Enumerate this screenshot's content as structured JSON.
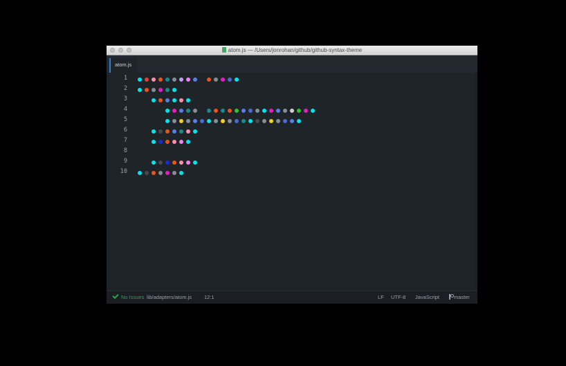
{
  "window": {
    "title": "atom.js — /Users/jonrohan/github/github-syntax-theme",
    "file_icon": "file-icon",
    "traffic_lights": [
      "close-button",
      "minimize-button",
      "zoom-button"
    ]
  },
  "tabs": [
    {
      "label": "atom.js",
      "active": true
    }
  ],
  "editor": {
    "line_numbers": [
      "1",
      "2",
      "3",
      "4",
      "5",
      "6",
      "7",
      "8",
      "9",
      "10"
    ],
    "colors": {
      "c": "#00e5ee",
      "r": "#e04040",
      "o": "#e8541e",
      "b": "#5a7ee8",
      "t": "#1a8a8a",
      "p": "#ee82ee",
      "g": "#888e96",
      "k": "#ff8fb0",
      "m": "#e020c0",
      "d": "#4a4a4a",
      "n": "#1a2ad8",
      "y": "#f0d020",
      "w": "#d0d0d0",
      "G": "#30c030",
      "l": "#c0a0f0",
      "B": "#4a6ad0"
    },
    "lines": [
      [
        "c",
        "r",
        "k",
        "o",
        "t",
        "g",
        "l",
        "p",
        "b",
        "_",
        "o",
        "g",
        "m",
        "B",
        "c"
      ],
      [
        "c",
        "o",
        "g",
        "m",
        "t",
        "c"
      ],
      [
        "_",
        "_",
        "c",
        "o",
        "b",
        "c",
        "k",
        "c"
      ],
      [
        "_",
        "_",
        "_",
        "_",
        "c",
        "m",
        "b",
        "t",
        "g",
        "_",
        "t",
        "o",
        "t",
        "o",
        "G",
        "b",
        "B",
        "g",
        "c",
        "m",
        "b",
        "g",
        "w",
        "G",
        "m",
        "c"
      ],
      [
        "_",
        "_",
        "_",
        "_",
        "c",
        "g",
        "y",
        "g",
        "b",
        "B",
        "c",
        "g",
        "y",
        "g",
        "B",
        "t",
        "c",
        "d",
        "g",
        "y",
        "g",
        "B",
        "b",
        "c"
      ],
      [
        "_",
        "_",
        "c",
        "d",
        "o",
        "b",
        "t",
        "k",
        "c"
      ],
      [
        "_",
        "_",
        "c",
        "n",
        "o",
        "k",
        "p",
        "c"
      ],
      [],
      [
        "_",
        "_",
        "c",
        "d",
        "n",
        "o",
        "k",
        "p",
        "c"
      ],
      [
        "c",
        "d",
        "o",
        "g",
        "m",
        "g",
        "c"
      ]
    ]
  },
  "status": {
    "issues": "No Issues",
    "file_path": "lib/adapters/atom.js",
    "cursor": "12:1",
    "line_ending": "LF",
    "encoding": "UTF-8",
    "grammar": "JavaScript",
    "branch": "master"
  }
}
